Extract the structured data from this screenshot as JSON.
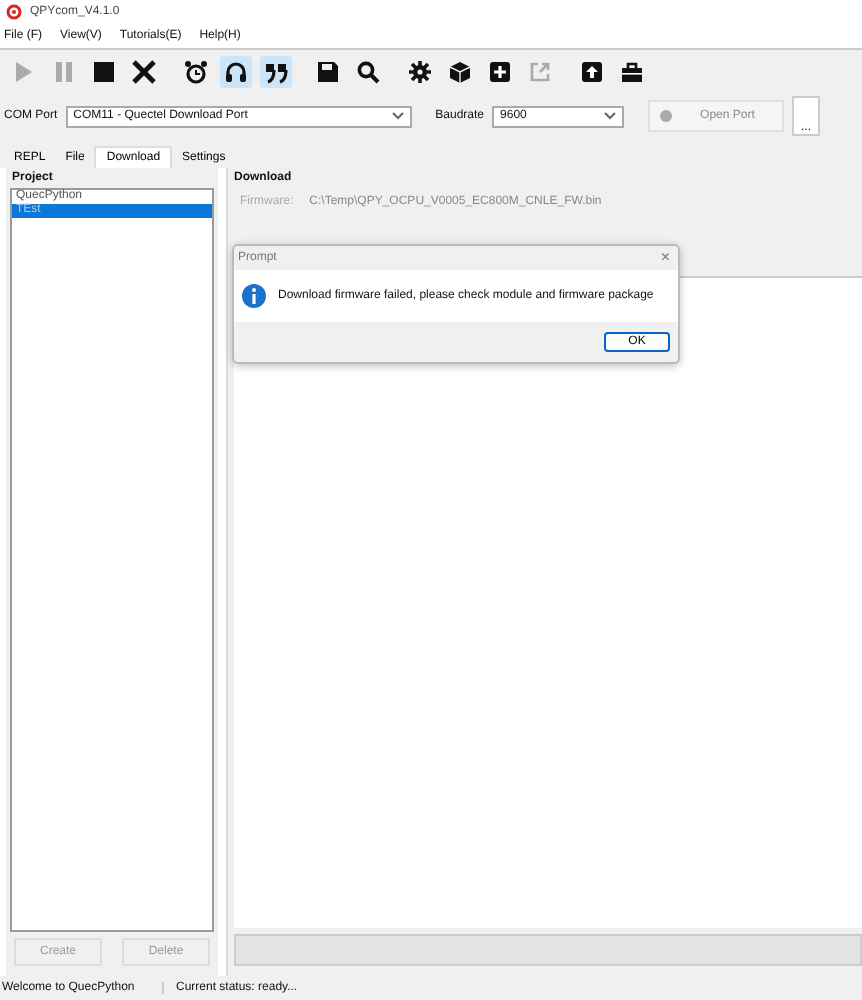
{
  "window": {
    "title": "QPYcom_V4.1.0"
  },
  "menu": [
    "File (F)",
    "View(V)",
    "Tutorials(E)",
    "Help(H)"
  ],
  "toolbar": [
    {
      "kind": "play",
      "disabled": true,
      "selected": false
    },
    {
      "kind": "pause",
      "disabled": true,
      "selected": false
    },
    {
      "kind": "stop",
      "disabled": false,
      "selected": false
    },
    {
      "kind": "close",
      "disabled": false,
      "selected": false
    },
    {
      "kind": "alarm",
      "disabled": false,
      "selected": false
    },
    {
      "kind": "headset",
      "disabled": false,
      "selected": true
    },
    {
      "kind": "quote",
      "disabled": false,
      "selected": true
    },
    {
      "kind": "save",
      "disabled": false,
      "selected": false
    },
    {
      "kind": "search",
      "disabled": false,
      "selected": false
    },
    {
      "kind": "gear",
      "disabled": false,
      "selected": false
    },
    {
      "kind": "cube",
      "disabled": false,
      "selected": false
    },
    {
      "kind": "plus",
      "disabled": false,
      "selected": false
    },
    {
      "kind": "export",
      "disabled": true,
      "selected": false
    },
    {
      "kind": "upload",
      "disabled": false,
      "selected": false
    },
    {
      "kind": "toolbox",
      "disabled": false,
      "selected": false
    }
  ],
  "port": {
    "label": "COM Port",
    "value": "COM11 - Quectel Download Port",
    "baud_label": "Baudrate",
    "baud_value": "9600",
    "open_button": "Open Port",
    "connected": false,
    "more_button": "..."
  },
  "tabs": [
    {
      "label": "REPL",
      "selected": false
    },
    {
      "label": "File",
      "selected": false
    },
    {
      "label": "Download",
      "selected": true
    },
    {
      "label": "Settings",
      "selected": false
    }
  ],
  "project": {
    "title": "Project",
    "items": [
      {
        "label": "QuecPython",
        "selected": false
      },
      {
        "label": "TEst",
        "selected": true
      }
    ],
    "buttons": [
      {
        "label": "Create",
        "disabled": true
      },
      {
        "label": "Delete",
        "disabled": true
      }
    ]
  },
  "progress": {
    "level": 0
  },
  "download": {
    "title": "Download",
    "firmware_label": "Firmware:",
    "firmware_value": "C:\\Temp\\QPY_OCPU_V0005_EC800M_CNLE_FW.bin"
  },
  "dialog": {
    "title": "Prompt",
    "close": "×",
    "message": "Download firmware failed, please check module and firmware package",
    "button": "OK"
  },
  "status_bar": [
    "Welcome to QuecPython",
    "Current status: ready..."
  ]
}
